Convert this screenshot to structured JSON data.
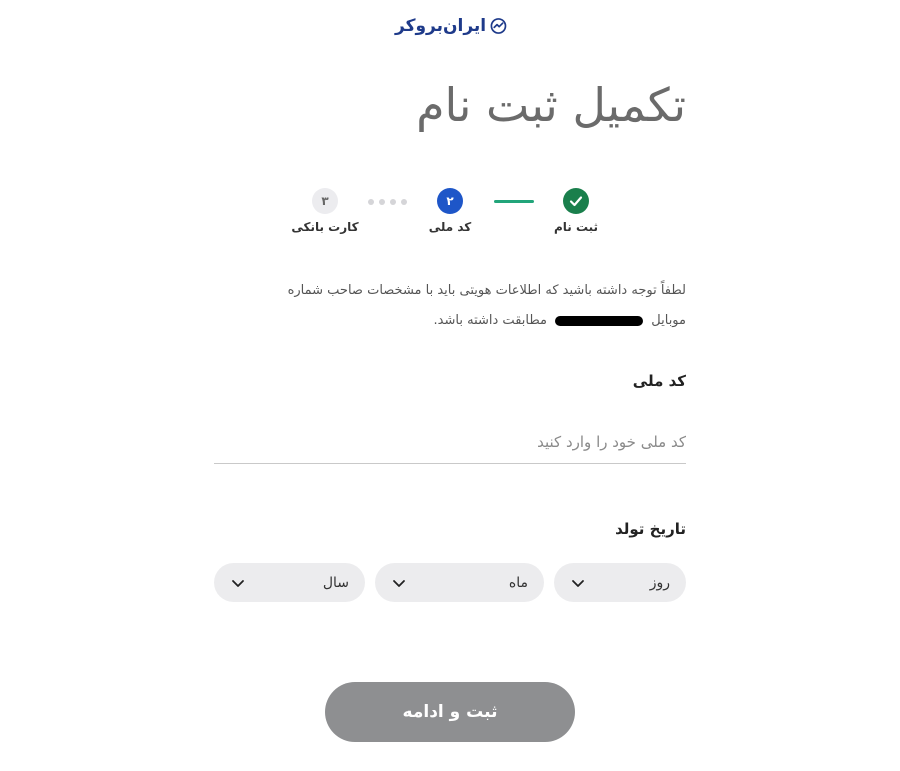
{
  "brand": {
    "name": "ایران‌بروکر",
    "logo_icon": "trend-check-icon",
    "color": "#1e3a8a"
  },
  "page": {
    "title": "تکمیل ثبت نام"
  },
  "stepper": {
    "steps": [
      {
        "number": "✓",
        "label": "ثبت نام",
        "state": "completed",
        "color": "#1a7f4c"
      },
      {
        "number": "۲",
        "label": "کد ملی",
        "state": "active",
        "color": "#1e56c8"
      },
      {
        "number": "۳",
        "label": "کارت بانکی",
        "state": "pending",
        "color": "#ececef"
      }
    ],
    "completed_connector_color": "#22a57a"
  },
  "notice": {
    "line1": "لطفاً توجه داشته باشید که اطلاعات هویتی باید با مشخصات صاحب شماره",
    "line2_before": "موبایل",
    "line2_after": "مطابقت داشته باشد."
  },
  "national_code": {
    "label": "کد ملی",
    "value": "",
    "placeholder": "کد ملی خود را وارد کنید"
  },
  "birth_date": {
    "label": "تاریخ تولد",
    "day": "روز",
    "month": "ماه",
    "year": "سال",
    "chevron_icon": "chevron-down-icon"
  },
  "submit": {
    "label": "ثبت و ادامه",
    "color": "#8e8f91"
  }
}
